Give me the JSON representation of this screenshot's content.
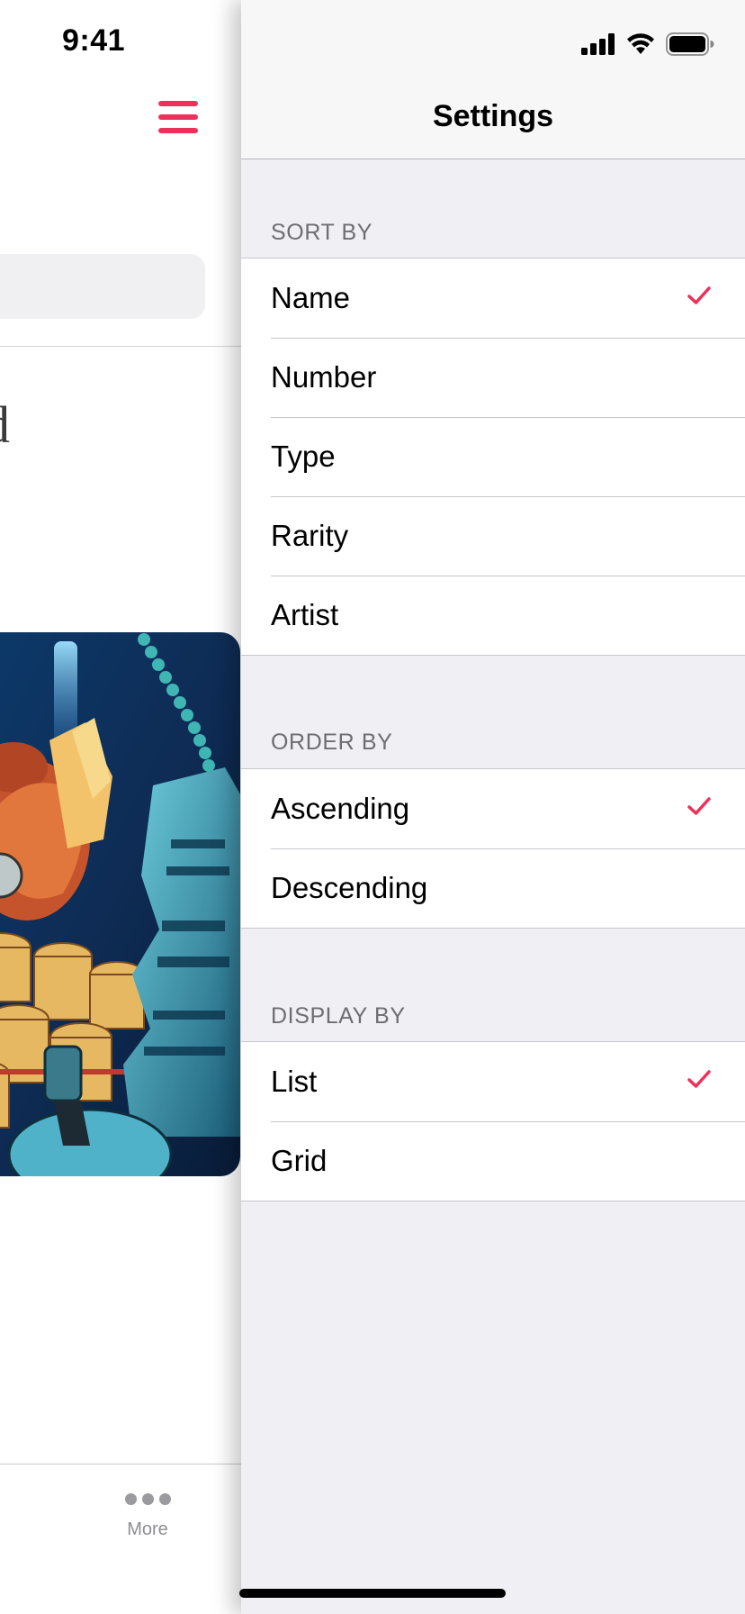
{
  "status_bar": {
    "time": "9:41"
  },
  "left_screen": {
    "partial_title": "d",
    "tab_bar": {
      "more_label": "More"
    }
  },
  "settings": {
    "title": "Settings",
    "accent_color": "#f0305a",
    "sections": {
      "sort_by": {
        "header": "SORT BY",
        "items": [
          "Name",
          "Number",
          "Type",
          "Rarity",
          "Artist"
        ],
        "selected": "Name"
      },
      "order_by": {
        "header": "ORDER BY",
        "items": [
          "Ascending",
          "Descending"
        ],
        "selected": "Ascending"
      },
      "display_by": {
        "header": "DISPLAY BY",
        "items": [
          "List",
          "Grid"
        ],
        "selected": "List"
      }
    }
  },
  "icons": [
    "hamburger-icon",
    "cellular-signal-icon",
    "wifi-icon",
    "battery-icon",
    "checkmark-icon",
    "more-icon"
  ]
}
